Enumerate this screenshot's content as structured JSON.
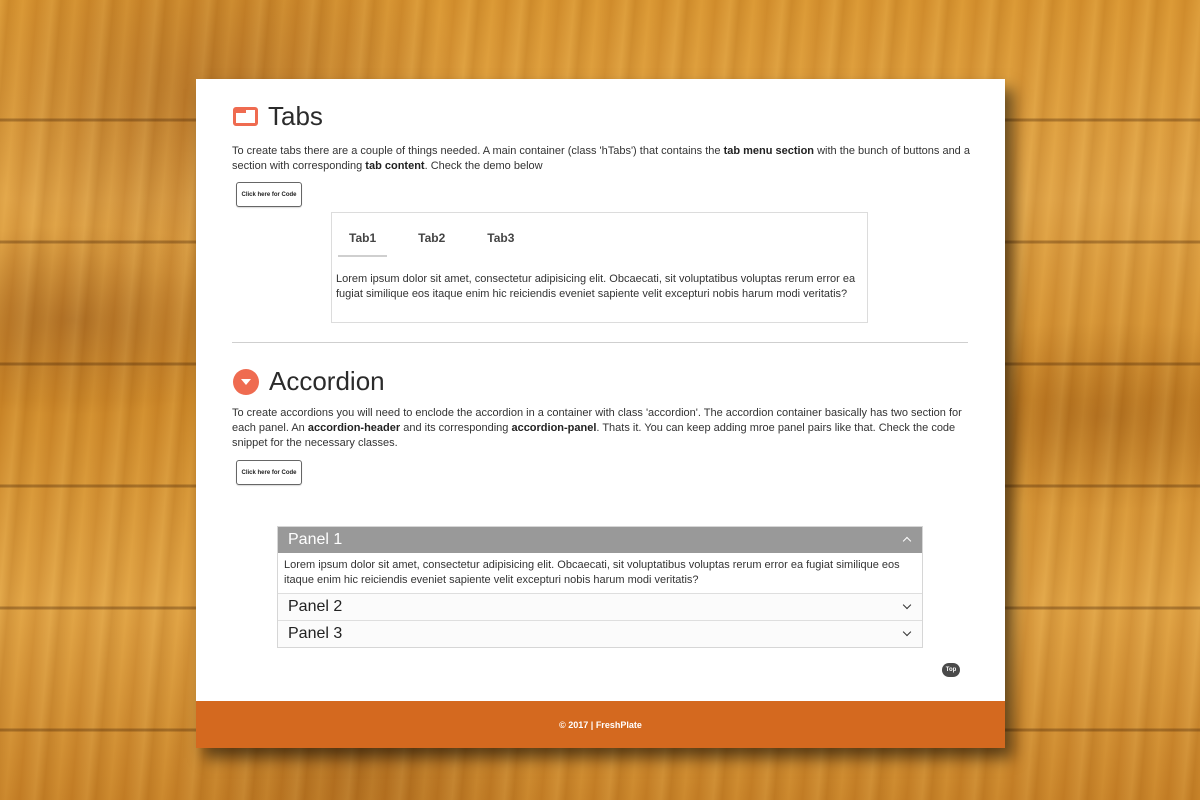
{
  "tabs_section": {
    "title": "Tabs",
    "icon": "tabs-icon",
    "desc": {
      "p1": "To create tabs there are a couple of things needed. A main container (class 'hTabs') that contains the ",
      "b1": "tab menu section",
      "p2": " with the bunch of buttons and a section with corresponding ",
      "b2": "tab content",
      "p3": ". Check the demo below"
    },
    "code_button": "Click here for Code",
    "tabs": [
      {
        "label": "Tab1",
        "active": true
      },
      {
        "label": "Tab2",
        "active": false
      },
      {
        "label": "Tab3",
        "active": false
      }
    ],
    "content": "Lorem ipsum dolor sit amet, consectetur adipisicing elit. Obcaecati, sit voluptatibus voluptas rerum error ea fugiat similique eos itaque enim hic reiciendis eveniet sapiente velit excepturi nobis harum modi veritatis?"
  },
  "accordion_section": {
    "title": "Accordion",
    "icon": "caret-down-circle-icon",
    "desc": {
      "p1": "To create accordions you will need to enclode the accordion in a container with class 'accordion'. The accordion container basically has two section for each panel. An ",
      "b1": "accordion-header",
      "p2": " and its corresponding ",
      "b2": "accordion-panel",
      "p3": ". Thats it. You can keep adding mroe panel pairs like that. Check the code snippet for the necessary classes."
    },
    "code_button": "Click here for Code",
    "panels": [
      {
        "header": "Panel 1",
        "open": true,
        "content": "Lorem ipsum dolor sit amet, consectetur adipisicing elit. Obcaecati, sit voluptatibus voluptas rerum error ea fugiat similique eos itaque enim hic reiciendis eveniet sapiente velit excepturi nobis harum modi veritatis?"
      },
      {
        "header": "Panel 2",
        "open": false
      },
      {
        "header": "Panel 3",
        "open": false
      }
    ]
  },
  "top_button": "Top",
  "footer": {
    "text": "© 2017 | FreshPlate"
  },
  "colors": {
    "accent": "#ef6b50",
    "footer": "#d4691f",
    "panel_header_open": "#999999"
  }
}
